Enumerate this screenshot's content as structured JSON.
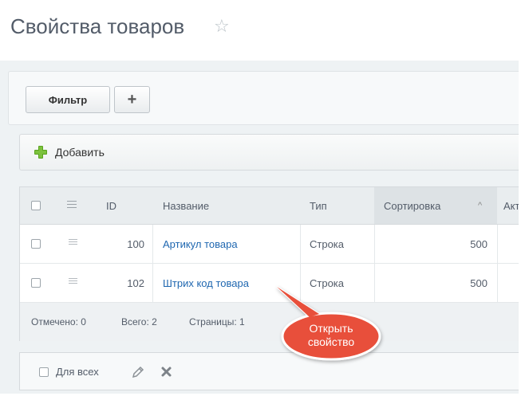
{
  "page": {
    "title": "Свойства товаров",
    "star_icon": "star-icon"
  },
  "toolbar": {
    "filter_label": "Фильтр",
    "plus_label": "+"
  },
  "add_bar": {
    "add_label": "Добавить",
    "add_icon": "plus-icon",
    "icon_color": "#5aa31f"
  },
  "grid": {
    "columns": [
      "ID",
      "Название",
      "Тип",
      "Сортировка",
      "Акт"
    ],
    "sort_indicator": "^",
    "rows": [
      {
        "id": "100",
        "name": "Артикул товара",
        "type": "Строка",
        "sort": "500"
      },
      {
        "id": "102",
        "name": "Штрих код товара",
        "type": "Строка",
        "sort": "500"
      }
    ],
    "footer": {
      "marked": "Отмечено: 0",
      "total": "Всего: 2",
      "pages": "Страницы: 1"
    }
  },
  "actions": {
    "for_all_label": "Для всех",
    "edit_icon": "pencil-icon",
    "delete_icon": "close-icon"
  },
  "callout": {
    "line1": "Открыть",
    "line2": "свойство",
    "color": "#e8503a"
  },
  "colors": {
    "link": "#1f67b0",
    "title": "#535c69",
    "background": "#eef2f4"
  }
}
